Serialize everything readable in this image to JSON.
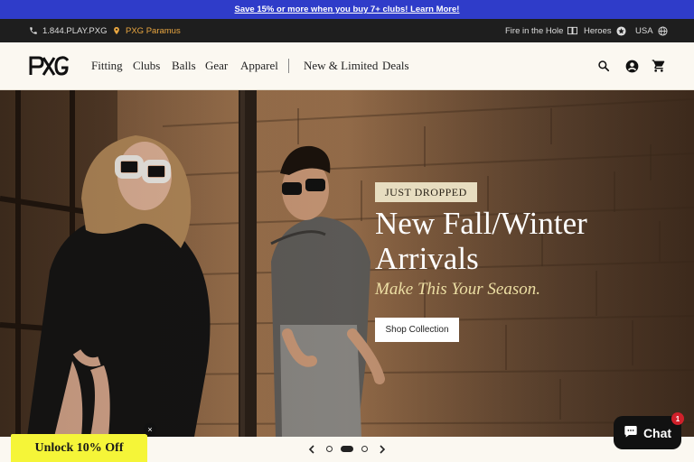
{
  "promo": {
    "text": "Save 15% or more when you buy 7+ clubs! Learn More!"
  },
  "utility": {
    "phone": "1.844.PLAY.PXG",
    "store": "PXG Paramus",
    "fire": "Fire in the Hole",
    "heroes": "Heroes",
    "region": "USA",
    "icons": [
      "phone-icon",
      "location-pin-icon",
      "book-icon",
      "star-badge-icon",
      "globe-icon"
    ]
  },
  "header": {
    "logo": "PXG",
    "nav": [
      "Fitting",
      "Clubs",
      "Balls",
      "Gear",
      "Apparel",
      "New & Limited",
      "Deals"
    ],
    "icons": [
      "search-icon",
      "account-icon",
      "cart-icon"
    ]
  },
  "hero": {
    "badge": "JUST DROPPED",
    "headline": "New Fall/Winter Arrivals",
    "tagline": "Make This Your Season.",
    "cta": "Shop Collection",
    "slides_total": 3,
    "active_slide": 2
  },
  "popup": {
    "unlock": "Unlock 10% Off",
    "close": "×"
  },
  "chat": {
    "label": "Chat",
    "unread": "1"
  },
  "colors": {
    "promo_bg": "#2f3cc9",
    "utility_bg": "#1e1e1e",
    "store_accent": "#e9a640",
    "tagline": "#eddfa4",
    "badge_bg": "#e7ddc0",
    "unlock_bg": "#f5f538"
  }
}
